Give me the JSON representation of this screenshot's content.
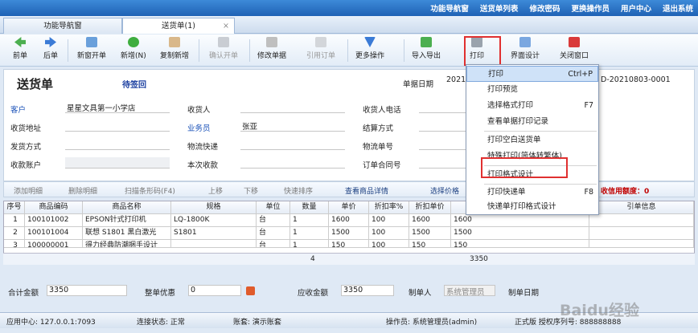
{
  "topmenu": [
    "功能导航窗",
    "送货单列表",
    "修改密码",
    "更换操作员",
    "用户中心",
    "退出系统"
  ],
  "tabs": [
    {
      "label": "功能导航窗"
    },
    {
      "label": "送货单(1)"
    }
  ],
  "toolbar": {
    "prev": "前单",
    "next": "后单",
    "new_window": "新窗开单",
    "add": "新增(N)",
    "copy_add": "复制新增",
    "confirm": "确认开单",
    "edit": "修改单据",
    "ref_order": "引用订单",
    "more": "更多操作",
    "import_export": "导入导出",
    "print": "打印",
    "layout": "界面设计",
    "close": "关闭窗口"
  },
  "form": {
    "title": "送货单",
    "status": "待签回",
    "doc_date_label": "单据日期",
    "doc_date_value": "2021",
    "doc_no_value": "D-20210803-0001",
    "customer_label": "客户",
    "customer_value": "星星文具第一小学店",
    "receiver_label": "收货人",
    "receiver_phone_label": "收货人电话",
    "address_label": "收货地址",
    "salesman_label": "业务员",
    "salesman_value": "张亚",
    "settle_label": "结算方式",
    "ship_label": "发货方式",
    "express_label": "物流快递",
    "track_label": "物流单号",
    "account_label": "收款账户",
    "this_receipt_label": "本次收款",
    "contract_label": "订单合同号"
  },
  "detail_toolbar": {
    "add_row": "添加明细",
    "del_row": "删除明细",
    "scan": "扫描条形码(F4)",
    "up": "上移",
    "down": "下移",
    "sort": "快速排序",
    "view_goods": "查看商品详情",
    "choose_price": "选择价格",
    "credit": "收信用额度：0"
  },
  "grid": {
    "headers": [
      "序号",
      "商品编码",
      "商品名称",
      "规格",
      "单位",
      "数量",
      "单价",
      "折扣率%",
      "折扣单价",
      "",
      "引单信息"
    ],
    "rows": [
      [
        "1",
        "100101002",
        "EPSON针式打印机",
        "LQ-1800K",
        "台",
        "1",
        "1600",
        "100",
        "1600",
        "1600",
        ""
      ],
      [
        "2",
        "100101004",
        "联想 S1801 黑白激光",
        "S1801",
        "台",
        "1",
        "1500",
        "100",
        "1500",
        "1500",
        ""
      ],
      [
        "3",
        "100000001",
        "得力经典防潮捆手设计",
        "",
        "台",
        "1",
        "150",
        "100",
        "150",
        "150",
        ""
      ]
    ],
    "sum_qty": "4",
    "sum_amount": "3350"
  },
  "bottom": {
    "total_label": "合计金额",
    "total_value": "3350",
    "discount_label": "整单优惠",
    "discount_value": "0",
    "receivable_label": "应收金额",
    "receivable_value": "3350",
    "maker_label": "制单人",
    "maker_value": "系统管理员",
    "make_date_label": "制单日期"
  },
  "statusbar": {
    "app_center": "应用中心: 127.0.0.1:7093",
    "conn": "连接状态: 正常",
    "book": "账套: 演示账套",
    "operator": "操作员: 系统管理员(admin)",
    "edition": "正式版 授权序列号: 888888888"
  },
  "print_menu": [
    {
      "label": "打印",
      "shortcut": "Ctrl+P"
    },
    {
      "label": "打印预览",
      "shortcut": ""
    },
    {
      "label": "选择格式打印",
      "shortcut": "F7"
    },
    {
      "label": "查看单据打印记录",
      "shortcut": ""
    },
    {
      "label": "打印空白送货单",
      "shortcut": ""
    },
    {
      "label": "特殊打印(简体转繁体)",
      "shortcut": ""
    },
    {
      "label": "打印格式设计",
      "shortcut": ""
    },
    {
      "label": "打印快递单",
      "shortcut": "F8"
    },
    {
      "label": "快递单打印格式设计",
      "shortcut": ""
    }
  ],
  "watermark": "Baidu经验",
  "colors": {
    "topbar": "#2a72c6",
    "highlight_box": "#e03030",
    "menu_selected": "#cfe2f8"
  }
}
